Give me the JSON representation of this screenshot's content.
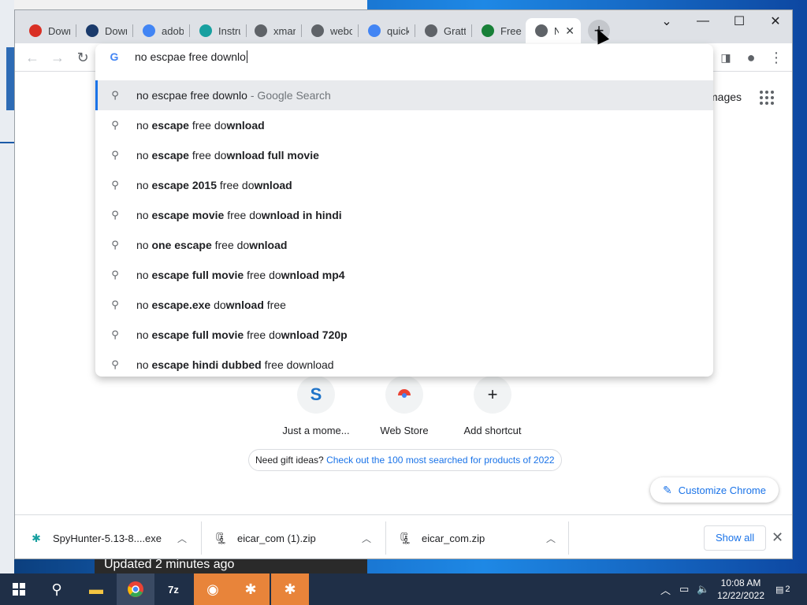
{
  "desktop": {
    "behind_window_text": "Updated 2 minutes ago"
  },
  "browser": {
    "tabs": [
      {
        "label": "Down",
        "icon": "target-icon",
        "color": "#d93025"
      },
      {
        "label": "Down",
        "icon": "q-icon",
        "color": "#1a3a6b"
      },
      {
        "label": "adobe",
        "icon": "google-icon",
        "color": "#4285f4"
      },
      {
        "label": "Instru",
        "icon": "person-icon",
        "color": "#18a0a0"
      },
      {
        "label": "xmarl",
        "icon": "globe-icon",
        "color": "#5f6368"
      },
      {
        "label": "webc",
        "icon": "globe-icon",
        "color": "#5f6368"
      },
      {
        "label": "quick",
        "icon": "google-icon",
        "color": "#4285f4"
      },
      {
        "label": "Gratt",
        "icon": "gratt-icon",
        "color": "#5f6368"
      },
      {
        "label": "Free",
        "icon": "check-icon",
        "color": "#188038"
      },
      {
        "label": "Ne",
        "icon": "chrome-icon",
        "color": "#5f6368",
        "active": true
      }
    ],
    "omnibox": {
      "typed": "no escpae free downlo",
      "suggestions": [
        {
          "parts": [
            {
              "t": "no escpae free downlo",
              "b": false
            }
          ],
          "suffix": "- Google Search",
          "highlighted": true
        },
        {
          "parts": [
            {
              "t": "no ",
              "b": false
            },
            {
              "t": "escape",
              "b": true
            },
            {
              "t": " free do",
              "b": false
            },
            {
              "t": "wnload",
              "b": true
            }
          ]
        },
        {
          "parts": [
            {
              "t": "no ",
              "b": false
            },
            {
              "t": "escape",
              "b": true
            },
            {
              "t": " free do",
              "b": false
            },
            {
              "t": "wnload full movie",
              "b": true
            }
          ]
        },
        {
          "parts": [
            {
              "t": "no ",
              "b": false
            },
            {
              "t": "escape 2015",
              "b": true
            },
            {
              "t": " free do",
              "b": false
            },
            {
              "t": "wnload",
              "b": true
            }
          ]
        },
        {
          "parts": [
            {
              "t": "no ",
              "b": false
            },
            {
              "t": "escape movie",
              "b": true
            },
            {
              "t": " free do",
              "b": false
            },
            {
              "t": "wnload in hindi",
              "b": true
            }
          ]
        },
        {
          "parts": [
            {
              "t": "no ",
              "b": false
            },
            {
              "t": "one escape",
              "b": true
            },
            {
              "t": " free do",
              "b": false
            },
            {
              "t": "wnload",
              "b": true
            }
          ]
        },
        {
          "parts": [
            {
              "t": "no ",
              "b": false
            },
            {
              "t": "escape full movie",
              "b": true
            },
            {
              "t": " free do",
              "b": false
            },
            {
              "t": "wnload mp4",
              "b": true
            }
          ]
        },
        {
          "parts": [
            {
              "t": "no ",
              "b": false
            },
            {
              "t": "escape.exe",
              "b": true
            },
            {
              "t": " do",
              "b": false
            },
            {
              "t": "wnload",
              "b": true
            },
            {
              "t": " free",
              "b": false
            }
          ]
        },
        {
          "parts": [
            {
              "t": "no ",
              "b": false
            },
            {
              "t": "escape full movie",
              "b": true
            },
            {
              "t": " free do",
              "b": false
            },
            {
              "t": "wnload 720p",
              "b": true
            }
          ]
        },
        {
          "parts": [
            {
              "t": "no ",
              "b": false
            },
            {
              "t": "escape hindi dubbed",
              "b": true
            },
            {
              "t": " free do",
              "b": false
            },
            {
              "t": "wnload",
              "b": false
            }
          ]
        }
      ]
    },
    "newtab_page": {
      "images_label": "mages",
      "shortcuts": [
        {
          "label": "Just a mome...",
          "icon": "s-icon"
        },
        {
          "label": "Web Store",
          "icon": "webstore-icon"
        },
        {
          "label": "Add shortcut",
          "icon": "plus-icon"
        }
      ],
      "gift_text": "Need gift ideas?",
      "gift_link": "Check out the 100 most searched for products of 2022",
      "customize_label": "Customize Chrome"
    },
    "downloads": {
      "items": [
        {
          "name": "SpyHunter-5.13-8....exe",
          "icon": "spyhunter-icon"
        },
        {
          "name": "eicar_com (1).zip",
          "icon": "zip-icon"
        },
        {
          "name": "eicar_com.zip",
          "icon": "zip-icon"
        }
      ],
      "show_all_label": "Show all"
    }
  },
  "taskbar": {
    "clock_time": "10:08 AM",
    "clock_date": "12/22/2022",
    "notification_count": "2"
  }
}
